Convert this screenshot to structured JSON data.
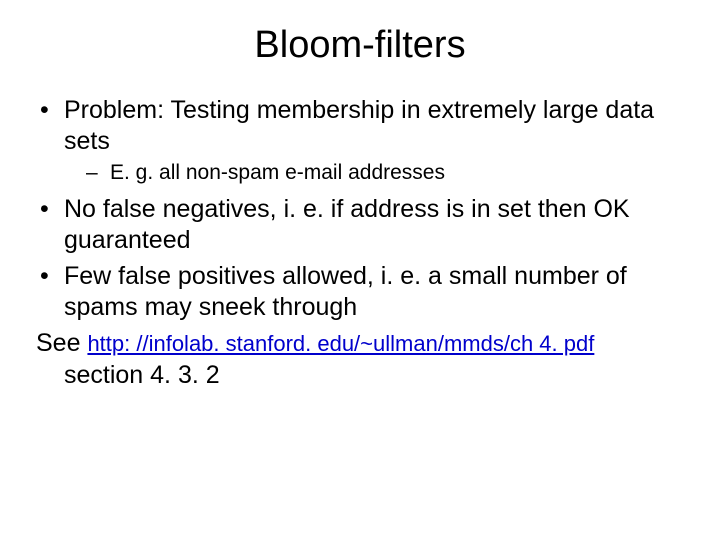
{
  "title": "Bloom-filters",
  "bullets": {
    "b1": "Problem: Testing membership in extremely large data sets",
    "b1_sub1": "E. g. all non-spam e-mail addresses",
    "b2": "No false negatives, i. e. if address is in set then OK guaranteed",
    "b3": "Few false positives allowed, i. e. a small number of spams may sneek through"
  },
  "see": {
    "prefix": "See ",
    "link_text": "http: //infolab. stanford. edu/~ullman/mmds/ch 4. pdf",
    "section": "section 4. 3. 2"
  }
}
